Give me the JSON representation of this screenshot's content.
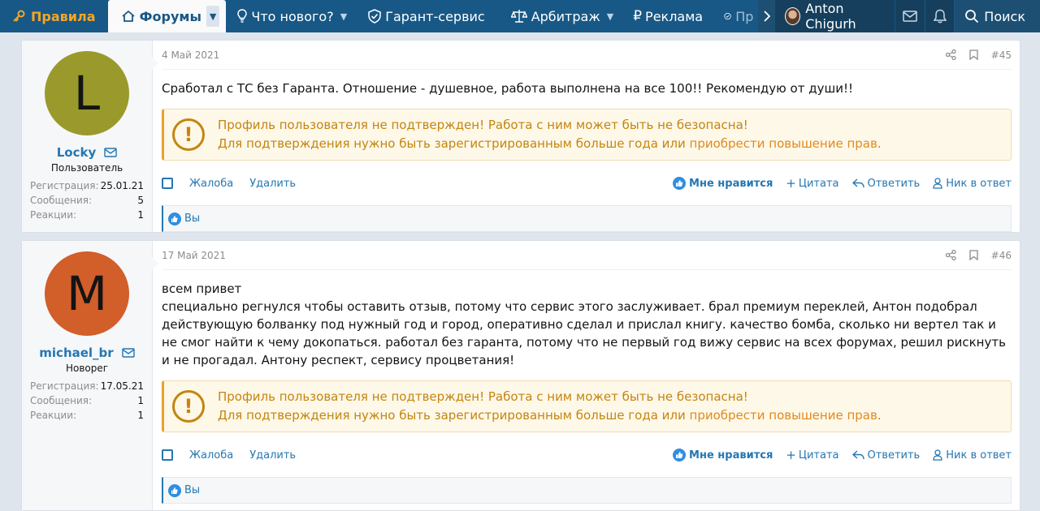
{
  "nav": {
    "rules": "Правила",
    "forums": "Форумы",
    "whats_new": "Что нового?",
    "guarantee": "Гарант-сервис",
    "arbitration": "Арбитраж",
    "ads": "Реклама",
    "truncated": "Пр",
    "user": "Anton Chigurh",
    "search": "Поиск"
  },
  "posts": [
    {
      "avatar_letter": "L",
      "avatar_color": "#999a2b",
      "username": "Locky",
      "user_title": "Пользователь",
      "stats": [
        {
          "label": "Регистрация:",
          "value": "25.01.21"
        },
        {
          "label": "Сообщения:",
          "value": "5"
        },
        {
          "label": "Реакции:",
          "value": "1"
        }
      ],
      "date": "4 Май 2021",
      "number": "#45",
      "text": "Сработал с ТС без Гаранта. Отношение - душевное, работа выполнена на все 100!! Рекомендую от души!!",
      "reactions": "Вы"
    },
    {
      "avatar_letter": "M",
      "avatar_color": "#d25e2a",
      "username": "michael_br",
      "user_title": "Новорег",
      "stats": [
        {
          "label": "Регистрация:",
          "value": "17.05.21"
        },
        {
          "label": "Сообщения:",
          "value": "1"
        },
        {
          "label": "Реакции:",
          "value": "1"
        }
      ],
      "date": "17 Май 2021",
      "number": "#46",
      "text_line1": "всем привет",
      "text_line2": "специально регнулся чтобы оставить отзыв, потому что сервис этого заслуживает. брал премиум переклей, Антон подобрал действующую болванку под нужный год и город, оперативно сделал и прислал книгу. качество бомба, сколько ни вертел так и не смог найти к чему докопаться. работал без гаранта, потому что не первый год вижу сервис на всех форумах, решил рискнуть и не прогадал. Антону респект, сервису процветания!",
      "reactions": "Вы"
    }
  ],
  "warning": {
    "line1": "Профиль пользователя не подтвержден! Работа с ним может быть не безопасна!",
    "line2_prefix": "Для подтверждения нужно быть зарегистрированным больше года или ",
    "line2_link": "приобрести повышение прав",
    "line2_suffix": "."
  },
  "actions": {
    "report": "Жалоба",
    "delete": "Удалить",
    "like": "Мне нравится",
    "quote": "Цитата",
    "reply": "Ответить",
    "nick": "Ник в ответ"
  },
  "colors": {
    "nav_bg": "#185886",
    "accent": "#2577b1",
    "rules": "#f5a623",
    "warning": "#c48510"
  }
}
